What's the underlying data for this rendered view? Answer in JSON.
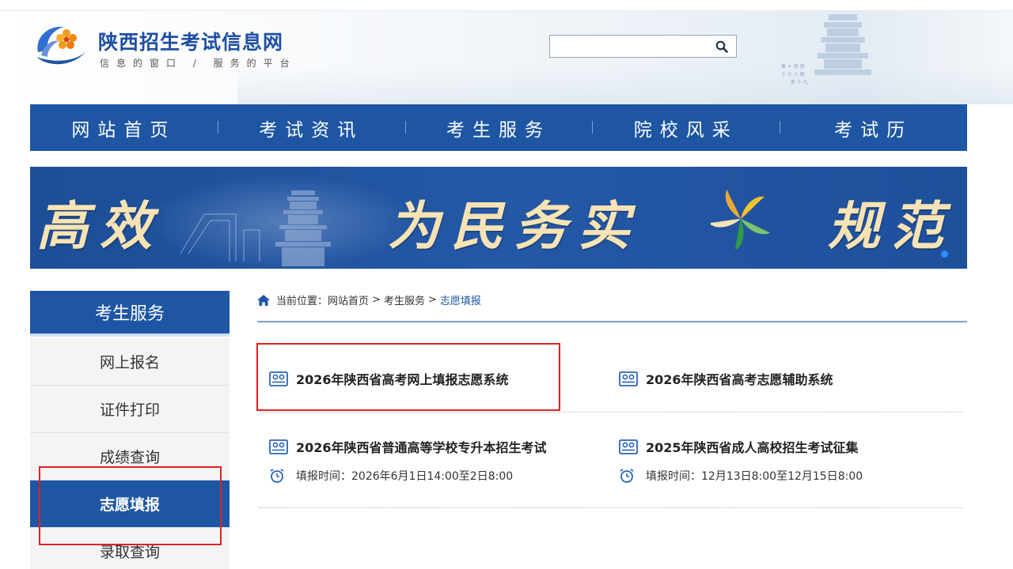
{
  "header": {
    "site_title": "陕西招生考试信息网",
    "slogan": "信息的窗口 / 服务的平台",
    "search_placeholder": ""
  },
  "nav": {
    "items": [
      "网站首页",
      "考试资讯",
      "考生服务",
      "院校风采",
      "考试历"
    ]
  },
  "banner": {
    "words": [
      "高效",
      "为民务实",
      "规范"
    ]
  },
  "sidebar": {
    "title": "考生服务",
    "items": [
      "网上报名",
      "证件打印",
      "成绩查询",
      "志愿填报",
      "录取查询"
    ],
    "active": "志愿填报"
  },
  "breadcrumb": {
    "prefix": "当前位置：",
    "home": "网站首页",
    "section": "考生服务",
    "current": "志愿填报",
    "sep": ">"
  },
  "links": [
    {
      "title": "2026年陕西省高考网上填报志愿系统"
    },
    {
      "title": "2026年陕西省高考志愿辅助系统"
    },
    {
      "title": "2026年陕西省普通高等学校专升本招生考试",
      "time": "填报时间：2026年6月1日14:00至2日8:00"
    },
    {
      "title": "2025年陕西省成人高校招生考试征集",
      "time": "填报时间：12月13日8:00至12月15日8:00"
    }
  ],
  "colors": {
    "primary_blue": "#1e56a3",
    "highlight_red": "#e02020",
    "banner_text": "#f7e3b4"
  }
}
